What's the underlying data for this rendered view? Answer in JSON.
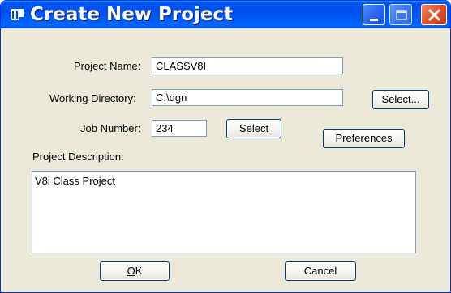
{
  "window": {
    "title": "Create New Project",
    "controls": [
      "minimize-icon",
      "maximize-icon",
      "close-icon"
    ]
  },
  "form": {
    "project_name_label": "Project Name:",
    "project_name_value": "CLASSV8I",
    "working_directory_label": "Working Directory:",
    "working_directory_value": "C:\\dgn",
    "job_number_label": "Job Number:",
    "job_number_value": "234",
    "project_description_label": "Project Description:",
    "project_description_value": "V8i Class Project"
  },
  "buttons": {
    "select_directory": "Select...",
    "select_job": "Select",
    "preferences": "Preferences",
    "ok_mnemonic": "O",
    "ok_rest": "K",
    "cancel": "Cancel"
  },
  "colors": {
    "titlebar": "#0053ee",
    "dialog_bg": "#ece9d8",
    "field_border": "#7f9db9",
    "button_border": "#003c74",
    "close_button": "#e0502a"
  }
}
